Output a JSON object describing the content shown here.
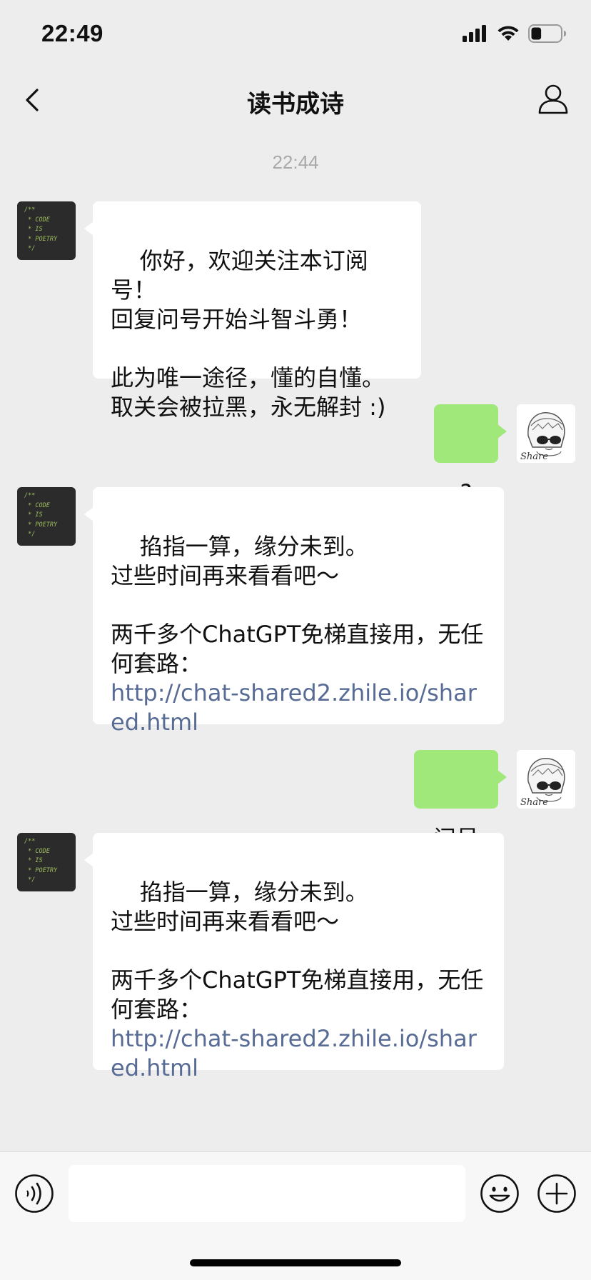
{
  "status_bar": {
    "time": "22:49",
    "battery_level": 0.35
  },
  "header": {
    "title": "读书成诗"
  },
  "chat": {
    "timestamp": "22:44",
    "left_avatar_text": "/**\n * CODE\n * IS\n * POETRY\n */",
    "right_avatar_text": "Share",
    "messages": [
      {
        "side": "in",
        "text": "你好，欢迎关注本订阅号！\n回复问号开始斗智斗勇！\n\n此为唯一途径，懂的自懂。\n取关会被拉黑，永无解封 :)"
      },
      {
        "side": "out",
        "text": "?"
      },
      {
        "side": "in",
        "text": "掐指一算，缘分未到。\n过些时间再来看看吧～\n\n两千多个ChatGPT免梯直接用，无任何套路：",
        "link": "http://chat-shared2.zhile.io/shared.html"
      },
      {
        "side": "out",
        "text": "问号"
      },
      {
        "side": "in",
        "text": "掐指一算，缘分未到。\n过些时间再来看看吧～\n\n两千多个ChatGPT免梯直接用，无任何套路：",
        "link": "http://chat-shared2.zhile.io/shared.html"
      }
    ]
  },
  "input_bar": {
    "placeholder": ""
  },
  "colors": {
    "background": "#ededed",
    "bubble_out": "#a0e87a",
    "bubble_in": "#ffffff",
    "link": "#576b95"
  }
}
